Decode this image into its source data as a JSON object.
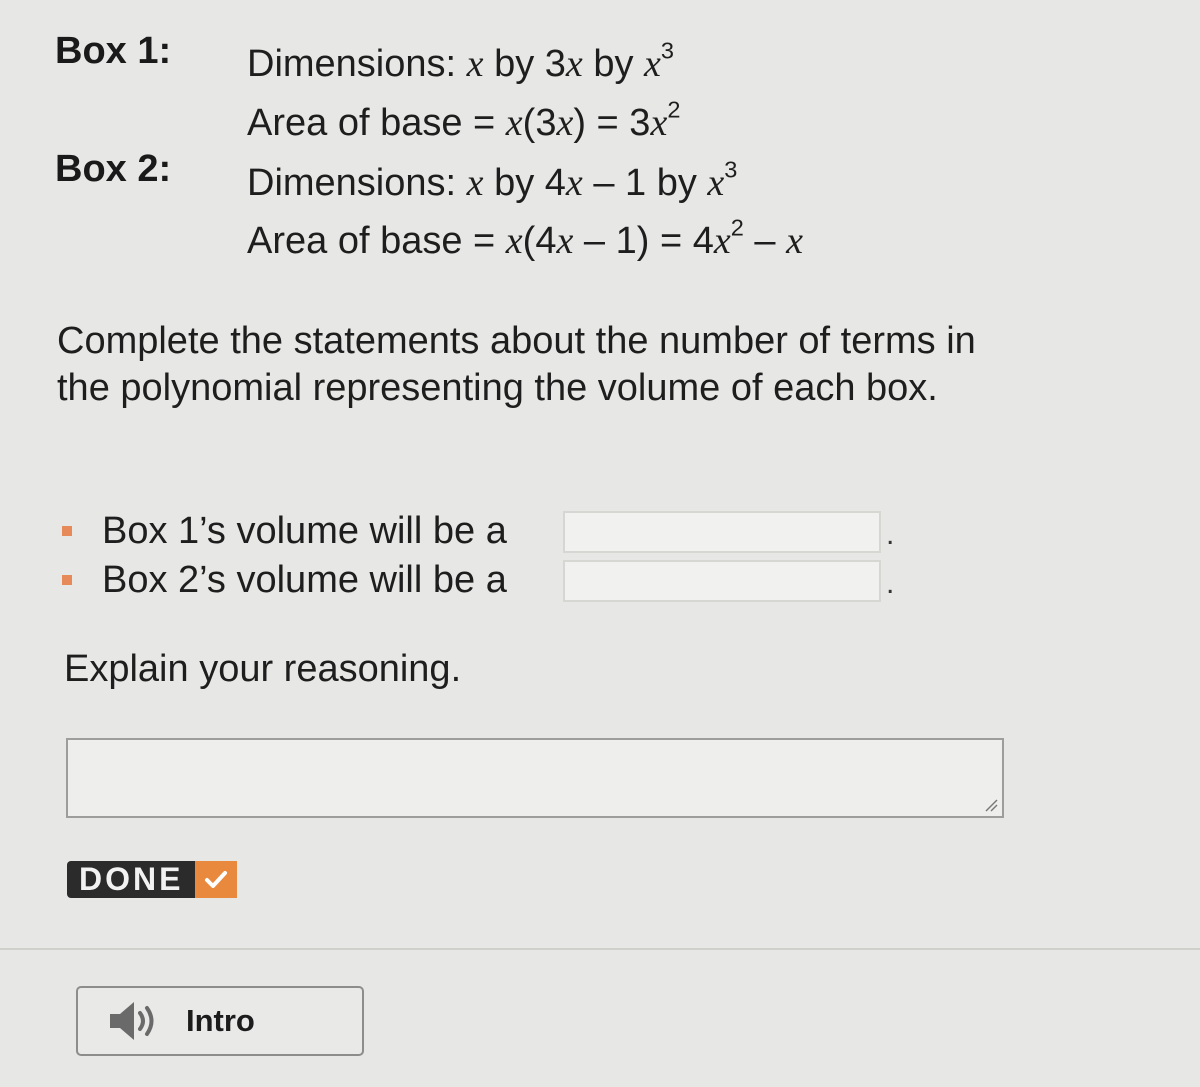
{
  "box1": {
    "label": "Box 1:",
    "dimensions_prefix": "Dimensions: ",
    "dimensions_a": "x",
    "dimensions_b": " by 3",
    "dimensions_c": "x",
    "dimensions_d": " by ",
    "dimensions_e": "x",
    "dimensions_exp": "3",
    "area_prefix": "Area of base = ",
    "area_a": "x",
    "area_b": "(3",
    "area_c": "x",
    "area_d": ") = 3",
    "area_e": "x",
    "area_exp": "2"
  },
  "box2": {
    "label": "Box 2:",
    "dimensions_prefix": "Dimensions: ",
    "dimensions_a": "x",
    "dimensions_b": " by 4",
    "dimensions_c": "x",
    "dimensions_d": " – 1 by ",
    "dimensions_e": "x",
    "dimensions_exp": "3",
    "area_prefix": "Area of base = ",
    "area_a": "x",
    "area_b": "(4",
    "area_c": "x",
    "area_d": " – 1) = 4",
    "area_e": "x",
    "area_exp": "2",
    "area_f": " – ",
    "area_g": "x"
  },
  "prompt": "Complete the statements about the number of terms in the polynomial representing the volume of each box.",
  "statements": [
    {
      "text": "Box 1’s volume will be a",
      "value": "",
      "end": "."
    },
    {
      "text": "Box 2’s volume will be a",
      "value": "",
      "end": "."
    }
  ],
  "explain_label": "Explain your reasoning.",
  "reasoning_value": "",
  "done_button": {
    "label": "DONE"
  },
  "intro_button": {
    "label": "Intro"
  },
  "colors": {
    "accent": "#e8893e",
    "bullet": "#e58a58",
    "done_bg": "#2b2b2b"
  }
}
